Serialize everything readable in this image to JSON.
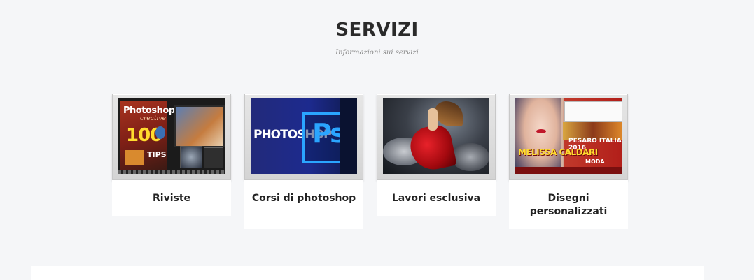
{
  "section": {
    "title": "SERVIZI",
    "subtitle": "Informazioni sui servizi"
  },
  "services": [
    {
      "label": "Riviste",
      "image": {
        "title": "Photoshop",
        "subtitle": "creative",
        "number": "100",
        "caption": "TIPS"
      }
    },
    {
      "label": "Corsi di photoshop",
      "image": {
        "word": "PHOTOSHOP",
        "logo": "Ps"
      }
    },
    {
      "label": "Lavori esclusiva",
      "image": {}
    },
    {
      "label": "Disegni personalizzati",
      "image": {
        "event": "PESARO ITALIA 2016",
        "name": "MELISSA CALDARI",
        "tag": "MODA"
      }
    }
  ],
  "colors": {
    "background": "#f5f6f8",
    "card_bg": "#ffffff",
    "title": "#2a2a2a",
    "subtitle": "#8a8a8a",
    "ps_blue": "#2aa5ff"
  }
}
